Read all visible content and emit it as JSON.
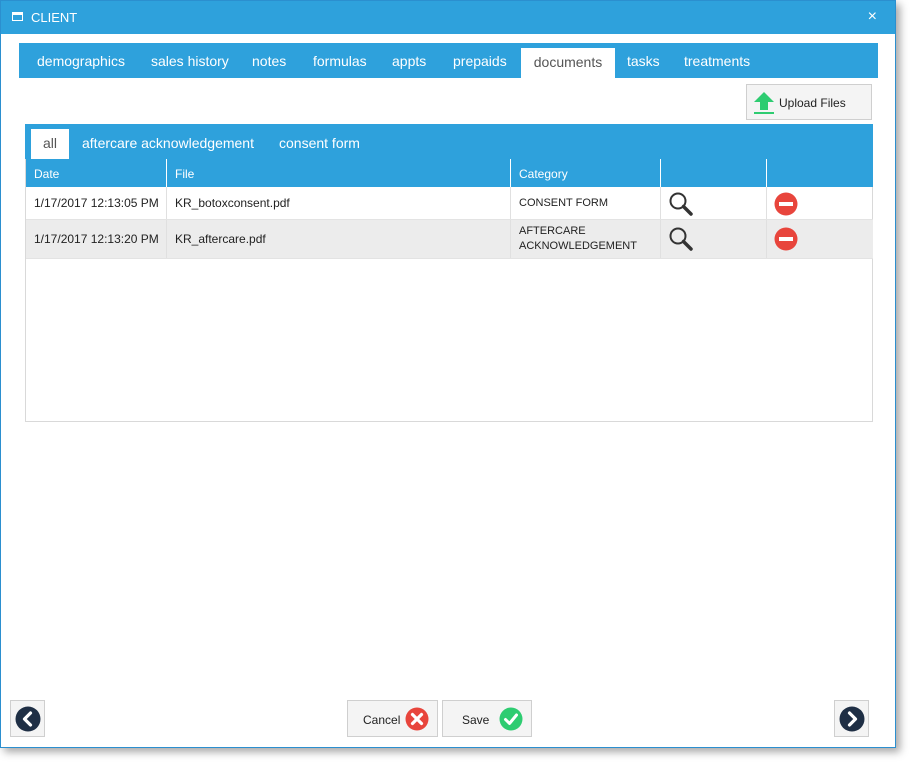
{
  "window": {
    "title": "CLIENT",
    "close_glyph": "×"
  },
  "tabs": [
    {
      "label": "demographics"
    },
    {
      "label": "sales history"
    },
    {
      "label": "notes"
    },
    {
      "label": "formulas"
    },
    {
      "label": "appts"
    },
    {
      "label": "prepaids"
    },
    {
      "label": "documents",
      "active": true
    },
    {
      "label": "tasks"
    },
    {
      "label": "treatments"
    }
  ],
  "upload": {
    "label": "Upload Files",
    "icon": "upload-arrow-icon"
  },
  "subtabs": [
    {
      "label": "all",
      "active": true
    },
    {
      "label": "aftercare acknowledgement"
    },
    {
      "label": "consent form"
    }
  ],
  "table": {
    "headers": [
      "Date",
      "File",
      "Category",
      "",
      ""
    ],
    "rows": [
      {
        "date": "1/17/2017 12:13:05 PM",
        "file": "KR_botoxconsent.pdf",
        "category_line1": "CONSENT FORM",
        "category_line2": ""
      },
      {
        "date": "1/17/2017 12:13:20 PM",
        "file": "KR_aftercare.pdf",
        "category_line1": "AFTERCARE",
        "category_line2": "ACKNOWLEDGEMENT"
      }
    ],
    "row_icons": [
      "magnifier-icon",
      "remove-icon"
    ]
  },
  "footer": {
    "cancel_label": "Cancel",
    "save_label": "Save",
    "prev_icon": "chevron-left-icon",
    "next_icon": "chevron-right-icon"
  },
  "colors": {
    "accent": "#2ea1dc",
    "cancel": "#e8453c",
    "save": "#2ecc71",
    "upload": "#2ecc71",
    "nav": "#1f2f45"
  }
}
